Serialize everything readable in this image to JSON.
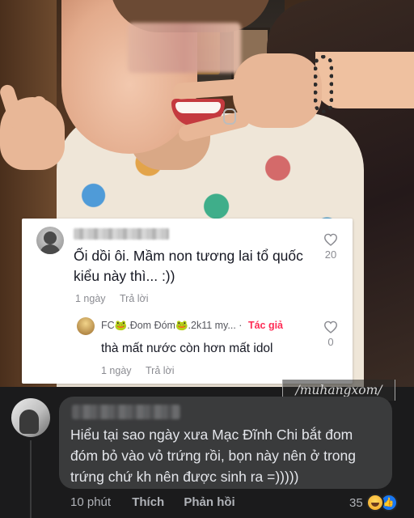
{
  "tiktok_comment": {
    "text": "Ối dồi ôi. Mầm non tương lai tổ quốc kiểu này thì... :))",
    "time": "1 ngày",
    "reply_label": "Trả lời",
    "likes": "20"
  },
  "tiktok_reply": {
    "username": "FC🐸.Đom Đóm🐸.2k11 my...",
    "separator": "·",
    "author_badge": "Tác giả",
    "text": "thà mất nước còn hơn mất idol",
    "time": "1 ngày",
    "reply_label": "Trả lời",
    "likes": "0"
  },
  "watermark": "/muhangxom/",
  "facebook_comment": {
    "text": "Hiểu tại sao ngày xưa Mạc Đĩnh Chi bắt đom đóm bỏ vào vỏ trứng rồi, bọn này nên ở trong trứng chứ kh nên được sinh ra =)))))",
    "time": "10 phút",
    "like_label": "Thích",
    "reply_label": "Phản hồi",
    "reaction_count": "35",
    "reactions": [
      "haha-reaction-icon",
      "like-reaction-icon"
    ]
  },
  "colors": {
    "tiktok_accent": "#fe2c55",
    "fb_bubble": "#3a3b3c",
    "fb_background": "#1b1b1c",
    "fb_like_blue": "#1877f2"
  }
}
